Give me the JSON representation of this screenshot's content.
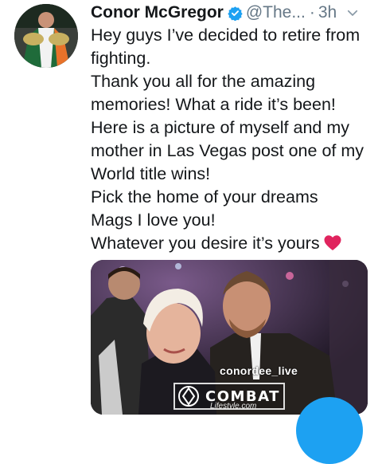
{
  "tweet": {
    "author_name": "Conor McGregor",
    "handle": "@The...",
    "separator": "·",
    "time": "3h",
    "verified": true,
    "lines": [
      "Hey guys I’ve decided to retire from fighting.",
      "Thank you all for the amazing memories! What a ride it’s been!",
      "Here is a picture of myself and my mother in Las Vegas post one of my World title wins!",
      "Pick the home of your dreams",
      "Mags I love you!",
      "Whatever you desire it’s yours"
    ],
    "emoji": "red-heart"
  },
  "photo": {
    "watermark": "conordee_live",
    "logo_text": "COMBAT",
    "logo_subtext": "Lifestyle.com"
  },
  "colors": {
    "verified": "#1da1f2",
    "secondary_text": "#657786",
    "primary_text": "#14171a",
    "heart": "#e0245e",
    "fab": "#1da1f2"
  }
}
